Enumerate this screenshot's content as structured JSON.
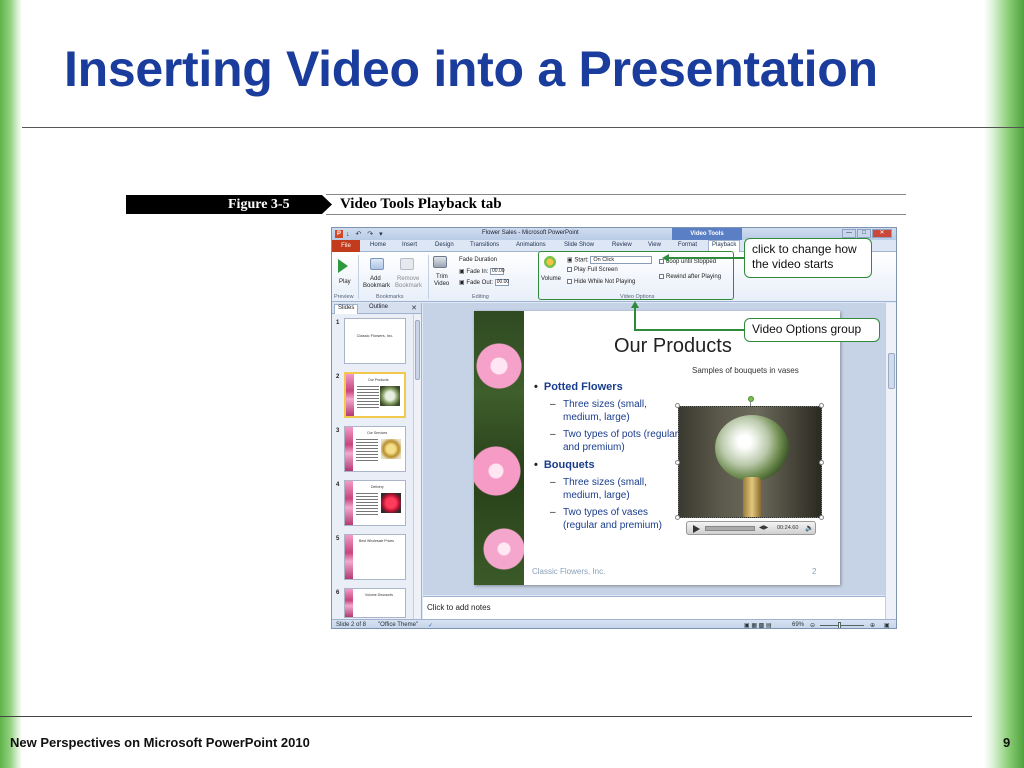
{
  "slide": {
    "title": "Inserting Video into a Presentation",
    "footer": "New Perspectives on Microsoft PowerPoint 2010",
    "page_number": "9"
  },
  "figure": {
    "number": "Figure 3-5",
    "caption": "Video Tools Playback tab"
  },
  "window": {
    "title": "Flower Sales - Microsoft PowerPoint",
    "context_tab_group": "Video Tools",
    "app_icon": "P",
    "qat": "↓ ↶ ↷ ▾",
    "controls": [
      "—",
      "□",
      "✕"
    ]
  },
  "tabs": [
    {
      "label": "File"
    },
    {
      "label": "Home"
    },
    {
      "label": "Insert"
    },
    {
      "label": "Design"
    },
    {
      "label": "Transitions"
    },
    {
      "label": "Animations"
    },
    {
      "label": "Slide Show"
    },
    {
      "label": "Review"
    },
    {
      "label": "View"
    },
    {
      "label": "Format"
    },
    {
      "label": "Playback"
    }
  ],
  "ribbon": {
    "preview": {
      "play": "Play",
      "group": "Preview"
    },
    "bookmarks": {
      "add": "Add",
      "add2": "Bookmark",
      "remove": "Remove",
      "remove2": "Bookmark",
      "group": "Bookmarks"
    },
    "editing": {
      "trim": "Trim",
      "trim2": "Video",
      "fade_duration": "Fade Duration",
      "fade_in": "Fade In:",
      "fade_in_value": "00.00",
      "fade_out": "Fade Out:",
      "fade_out_value": "00.00",
      "group": "Editing"
    },
    "video_options": {
      "volume": "Volume",
      "start": "Start:",
      "start_value": "On Click",
      "play_full_screen": "Play Full Screen",
      "hide_while_not_playing": "Hide While Not Playing",
      "loop_until_stopped": "Loop until Stopped",
      "rewind_after_playing": "Rewind after Playing",
      "group": "Video Options"
    }
  },
  "pane": {
    "tabs": [
      "Slides",
      "Outline"
    ],
    "close": "✕",
    "thumbnails": [
      {
        "num": "1",
        "title": "Classic Flowers, Inc."
      },
      {
        "num": "2",
        "title": "Our Products"
      },
      {
        "num": "3",
        "title": "Our Services"
      },
      {
        "num": "4",
        "title": "Delivery"
      },
      {
        "num": "5",
        "title": "Best Wholesale Prices"
      },
      {
        "num": "6",
        "title": "Volume Discounts"
      }
    ]
  },
  "current_slide": {
    "title": "Our Products",
    "subcaption": "Samples of bouquets in vases",
    "bullets": [
      {
        "text": "Potted Flowers",
        "subs": [
          "Three sizes (small, medium, large)",
          "Two types of pots (regular and premium)"
        ]
      },
      {
        "text": "Bouquets",
        "subs": [
          "Three sizes (small, medium, large)",
          "Two types of vases (regular and premium)"
        ]
      }
    ],
    "footer": "Classic Flowers, Inc.",
    "number": "2",
    "video_time": "00:24.60"
  },
  "notes_placeholder": "Click to add notes",
  "status": {
    "slide_of": "Slide 2 of 8",
    "theme": "\"Office Theme\"",
    "zoom": "69%"
  },
  "callouts": {
    "start": "click to change how the video starts",
    "group": "Video Options group"
  },
  "colors": {
    "title_blue": "#1a3c9c",
    "callout_green": "#2f8a3c",
    "file_tab": "#c13b1c"
  }
}
